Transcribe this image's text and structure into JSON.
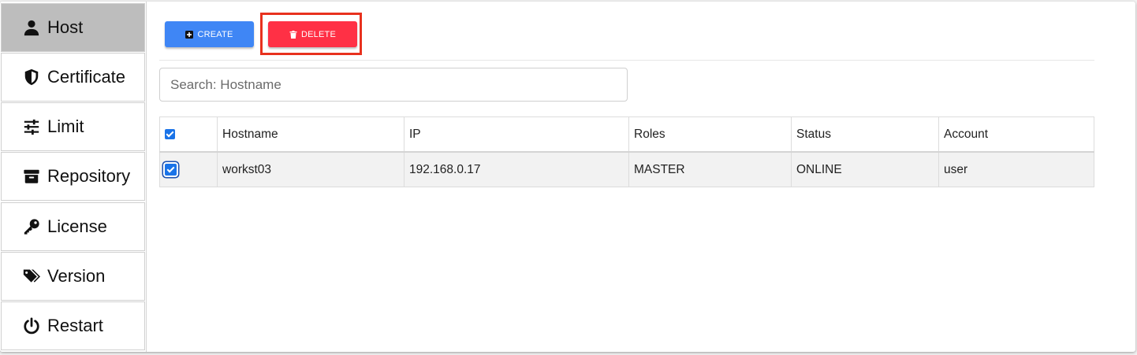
{
  "sidebar": {
    "items": [
      {
        "label": "Host",
        "icon": "user-icon",
        "active": true
      },
      {
        "label": "Certificate",
        "icon": "shield-icon",
        "active": false
      },
      {
        "label": "Limit",
        "icon": "sliders-icon",
        "active": false
      },
      {
        "label": "Repository",
        "icon": "archive-icon",
        "active": false
      },
      {
        "label": "License",
        "icon": "key-icon",
        "active": false
      },
      {
        "label": "Version",
        "icon": "tags-icon",
        "active": false
      },
      {
        "label": "Restart",
        "icon": "power-icon",
        "active": false
      }
    ]
  },
  "toolbar": {
    "create_label": "CREATE",
    "delete_label": "DELETE",
    "create_color": "#3f86f5",
    "delete_color": "#ff3045"
  },
  "search": {
    "placeholder": "Search: Hostname"
  },
  "table": {
    "headers": [
      "Hostname",
      "IP",
      "Roles",
      "Status",
      "Account"
    ],
    "select_all_checked": true,
    "rows": [
      {
        "checked": true,
        "hostname": "workst03",
        "ip": "192.168.0.17",
        "roles": "MASTER",
        "status": "ONLINE",
        "account": "user"
      }
    ]
  }
}
